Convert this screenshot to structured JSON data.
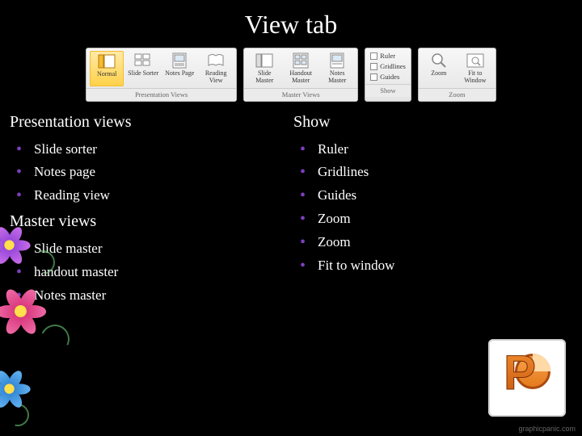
{
  "title": "View tab",
  "ribbon": {
    "groups": [
      {
        "label": "Presentation Views",
        "buttons": [
          {
            "label": "Normal",
            "icon": "normal-view",
            "active": true
          },
          {
            "label": "Slide Sorter",
            "icon": "slide-sorter"
          },
          {
            "label": "Notes Page",
            "icon": "notes-page"
          },
          {
            "label": "Reading View",
            "icon": "reading-view"
          }
        ]
      },
      {
        "label": "Master Views",
        "buttons": [
          {
            "label": "Slide Master",
            "icon": "slide-master"
          },
          {
            "label": "Handout Master",
            "icon": "handout-master"
          },
          {
            "label": "Notes Master",
            "icon": "notes-master"
          }
        ]
      },
      {
        "label": "Show",
        "checks": [
          {
            "label": "Ruler"
          },
          {
            "label": "Gridlines"
          },
          {
            "label": "Guides"
          }
        ]
      },
      {
        "label": "Zoom",
        "buttons": [
          {
            "label": "Zoom",
            "icon": "zoom"
          },
          {
            "label": "Fit to Window",
            "icon": "fit-window"
          }
        ]
      }
    ]
  },
  "left": {
    "sections": [
      {
        "heading": "Presentation views",
        "items": [
          "Slide sorter",
          "Notes page",
          "Reading view"
        ]
      },
      {
        "heading": "Master views",
        "items": [
          "Slide master",
          "handout master",
          "Notes master"
        ]
      }
    ]
  },
  "right": {
    "sections": [
      {
        "heading": "Show",
        "items": [
          "Ruler",
          "Gridlines",
          "Guides",
          "Zoom",
          "Zoom",
          "Fit to window"
        ]
      }
    ]
  },
  "watermark": "graphicpanic.com"
}
